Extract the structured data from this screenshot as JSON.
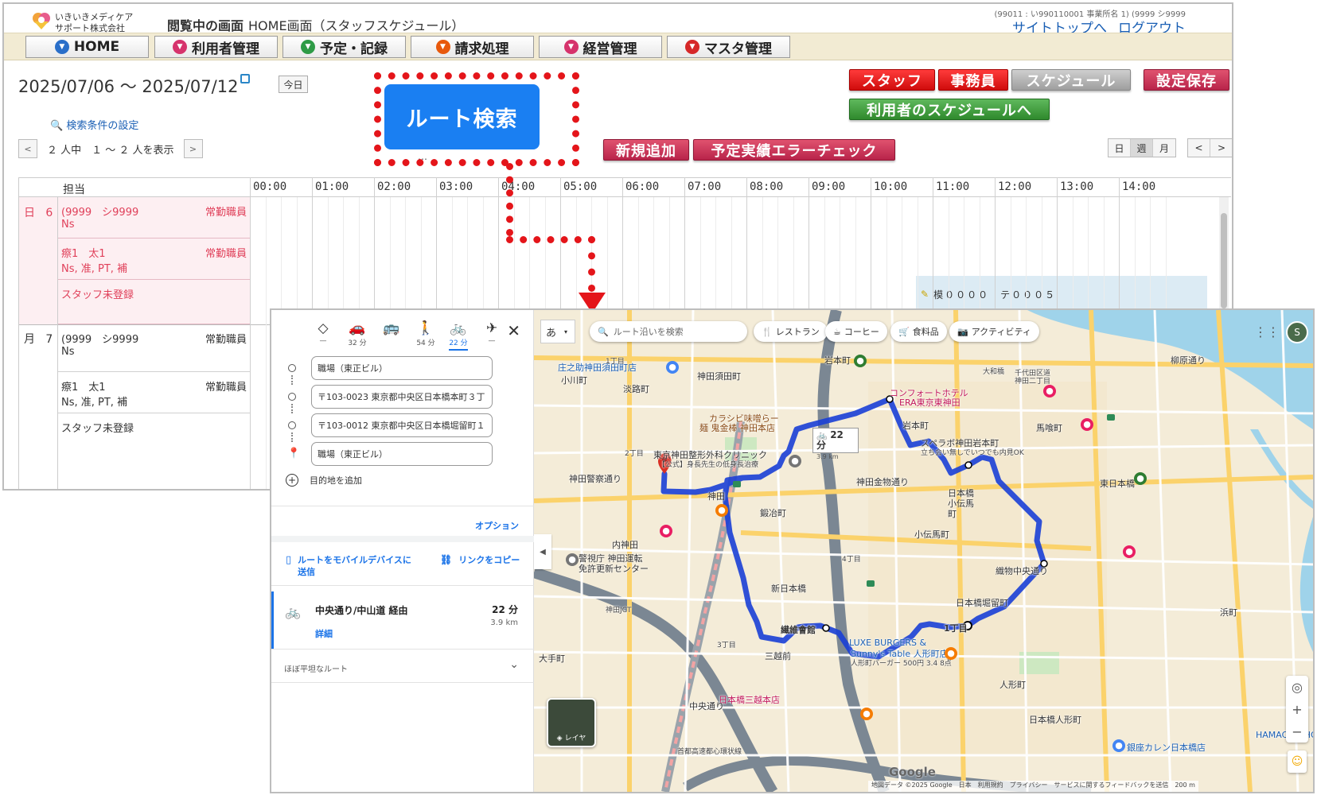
{
  "app": {
    "logo_line1": "いきいきメディケア",
    "logo_line2": "サポート株式会社",
    "viewing_label": "閲覧中の画面",
    "viewing_value": "HOME画面（スタッフスケジュール）",
    "account_info": "(99011 : い990110001 事業所名 1)  (9999  シ9999",
    "link_sitetop": "サイトトップへ",
    "link_logout": "ログアウト",
    "nav": [
      {
        "label": "HOME",
        "color": "#2a6fc9"
      },
      {
        "label": "利用者管理",
        "color": "#d6336c"
      },
      {
        "label": "予定・記録",
        "color": "#2e9b46"
      },
      {
        "label": "請求処理",
        "color": "#e8590c"
      },
      {
        "label": "経営管理",
        "color": "#d6336c"
      },
      {
        "label": "マスタ管理",
        "color": "#d62828"
      }
    ],
    "date_range": "2025/07/06 〜 2025/07/12",
    "today_label": "今日",
    "search_cond": "検索条件の設定",
    "pager_text": "２ 人中　１ 〜 ２ 人を表示",
    "route_search_label": "ルート検索",
    "btn_staff": "スタッフ",
    "btn_office": "事務員",
    "btn_schedule": "スケジュール",
    "btn_save": "設定保存",
    "btn_user_schedule": "利用者のスケジュールへ",
    "btn_new": "新規追加",
    "btn_error_check": "予定実績エラーチェック",
    "view_day": "日",
    "view_week": "週",
    "view_month": "月",
    "grid_header_tanto": "担当",
    "hours": [
      "00:00",
      "01:00",
      "02:00",
      "03:00",
      "04:00",
      "05:00",
      "06:00",
      "07:00",
      "08:00",
      "09:00",
      "10:00",
      "11:00",
      "12:00",
      "13:00",
      "14:00"
    ],
    "days": [
      {
        "dow": "日",
        "day": "6",
        "rows": [
          {
            "name": "(9999　シ9999",
            "qual": "Ns",
            "type": "常勤職員"
          },
          {
            "name": "瘵1　太1",
            "qual": "Ns, 准, PT, 補",
            "type": "常勤職員"
          },
          {
            "name": "スタッフ未登録",
            "qual": "",
            "type": ""
          }
        ]
      },
      {
        "dow": "月",
        "day": "7",
        "rows": [
          {
            "name": "(9999　シ9999",
            "qual": "Ns",
            "type": "常勤職員"
          },
          {
            "name": "瘵1　太1",
            "qual": "Ns, 准, PT, 補",
            "type": "常勤職員"
          },
          {
            "name": "スタッフ未登録",
            "qual": "",
            "type": ""
          }
        ]
      }
    ],
    "assign_text": "模００００　テ０００５"
  },
  "map": {
    "modes": [
      {
        "icon": "◇",
        "time": "—"
      },
      {
        "icon": "🚗",
        "time": "32 分"
      },
      {
        "icon": "🚌",
        "time": ""
      },
      {
        "icon": "🚶",
        "time": "54 分"
      },
      {
        "icon": "🚲",
        "time": "22 分"
      },
      {
        "icon": "✈",
        "time": "—"
      }
    ],
    "waypoints": [
      "職場（東正ビル）",
      "〒103-0023 東京都中央区日本橋本町３丁",
      "〒103-0012 東京都中央区日本橋堀留町１",
      "職場（東正ビル）"
    ],
    "add_destination": "目的地を追加",
    "options": "オプション",
    "send_mobile": "ルートをモバイルデバイスに送信",
    "copy_link": "リンクをコピー",
    "route_via": "中央通り/中山道 経由",
    "route_detail": "詳細",
    "route_time": "22 分",
    "route_distance": "3.9 km",
    "flat_route": "ほぼ平坦なルート",
    "ime": "あ",
    "search_placeholder": "ルート沿いを検索",
    "chip_restaurant": "レストラン",
    "chip_coffee": "コーヒー",
    "chip_grocery": "食料品",
    "chip_activity": "アクティビティ",
    "box_time": "22 分",
    "box_dist": "3.9 km",
    "layer": "レイヤ",
    "avatar": "S",
    "attribution": "地図データ ©2025 Google　日本　利用規約　プライバシー　サービスに関するフィードバックを送信　200 m",
    "google": "Google",
    "labels": {
      "kanda_sudacho": "神田須田町",
      "iwamotocho": "岩本町",
      "iwamotocho2": "岩本町",
      "kandastation": "神田",
      "kajicho": "鍛冶町",
      "kodenmacho": "小伝馬町",
      "nihonbashi_kodenmacho": "日本橋小伝馬町",
      "shinnihonbashi": "新日本橋",
      "nihonbashi_horidomecho": "日本橋堀留町",
      "ningyocho": "人形町",
      "nihonbashi_ningyocho": "日本橋人形町",
      "mitsukoshimae": "三越前",
      "nihonbashi_mitsukoshi": "日本橋三越本店",
      "bakurocho": "馬喰町",
      "higashinihonbashi": "東日本橋",
      "hamacho": "浜町",
      "awajicho": "淡路町",
      "ogawamachi": "小川町",
      "uchikanda": "内神田",
      "otemachi": "大手町",
      "kanda_keisatsu": "神田警察通り",
      "kanda_kanamono": "神田金物通り",
      "chuo_dori": "中央通り",
      "orimono_chuo": "織物中央通り",
      "sen_i_kaikan": "繊維會館",
      "luxe": "LUXE BURGERS &",
      "sunnys": "Sunny's Table 人形町店",
      "sunnys_sub": "人形町バーガー 500円 3.4 8点",
      "comfort": "コンフォートホテル",
      "comfort2": "ERA東京東神田",
      "karashi": "カラシビ味噌らー",
      "karashi2": "麺 鬼金棒 神田本店",
      "clinic": "東京神田整形外科クリニック",
      "clinic2": "【公式】身長先生の低身長治療",
      "spelabo": "スペラボ神田岩本町",
      "spelabo2": "立ち会い無しでいつでも内見OK",
      "police": "警視庁 神田運転",
      "police2": "免許更新センター",
      "izumicho": "庄之助神田須田町店",
      "ginza_karen": "銀座カレン日本橋店",
      "hamacho_hotel": "HAMACHO HOTE",
      "daiwa": "大和橋",
      "chiyoda": "千代田区道",
      "chiyoda2": "神田二丁目",
      "yanagibashi": "柳原通り",
      "kanda_jct": "神田JCT",
      "shuto": "首都高速都心環状線",
      "ichome": "1丁目",
      "nichome": "2丁目",
      "sanchome": "3丁目",
      "yonchome": "4丁目",
      "ichome_end": "1丁目"
    }
  }
}
